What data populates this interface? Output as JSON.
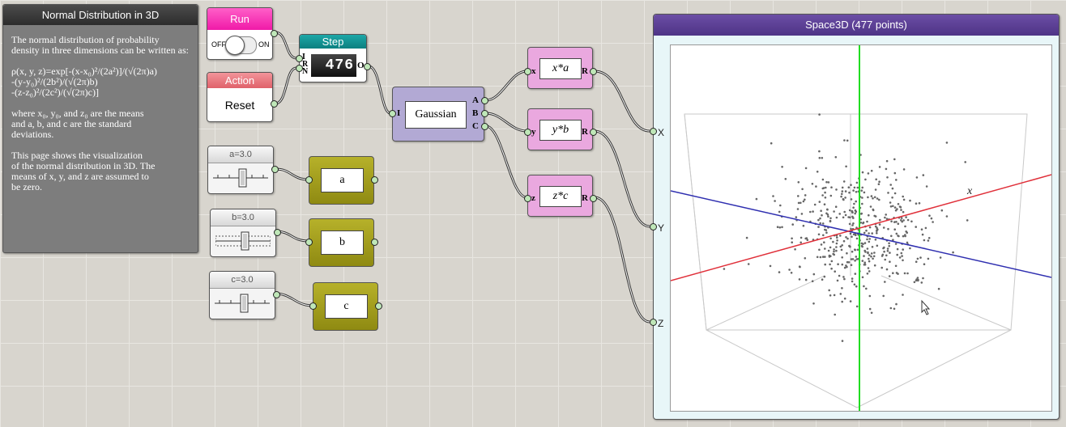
{
  "info": {
    "title": "Normal Distribution in 3D",
    "p1": "The normal distribution of probability density in three dimensions can be written as:",
    "p2": "ρ(x, y, z)=exp[-(x-x₀)²/(2a²)]/(√(2π)a)\n-(y-y₀)²/(2b²)/(√(2π)b)\n-(z-z₀)²/(2c²)/(√(2π)c)]",
    "p3": "where x₀, y₀, and z₀ are the means\nand a, b, and c are the standard\ndeviations.",
    "p4": "This page shows the visualization\nof the normal distribution in 3D. The\nmeans of x, y, and z are assumed to\nbe zero."
  },
  "run": {
    "title": "Run",
    "off": "OFF",
    "on": "ON"
  },
  "action": {
    "title": "Action",
    "button": "Reset"
  },
  "step": {
    "title": "Step",
    "value": "476",
    "inputs": [
      "I",
      "R",
      "N"
    ],
    "output": "O"
  },
  "gaussian": {
    "label": "Gaussian",
    "input": "I",
    "outputs": [
      "A",
      "B",
      "C"
    ]
  },
  "expressions": [
    {
      "in": "x",
      "expr": "x*a",
      "out": "R"
    },
    {
      "in": "y",
      "expr": "y*b",
      "out": "R"
    },
    {
      "in": "z",
      "expr": "z*c",
      "out": "R"
    }
  ],
  "sliders": [
    {
      "label": "a=3.0",
      "var": "a",
      "value": 3.0
    },
    {
      "label": "b=3.0",
      "var": "b",
      "value": 3.0
    },
    {
      "label": "c=3.0",
      "var": "c",
      "value": 3.0
    }
  ],
  "space3d": {
    "title": "Space3D (477 points)",
    "inputs": [
      "X",
      "Y",
      "Z"
    ],
    "axis_label": "x",
    "colors": {
      "x_axis": "#e0303a",
      "y_axis": "#2f2fb0",
      "z_axis": "#22dd22",
      "points": "#666666"
    }
  }
}
